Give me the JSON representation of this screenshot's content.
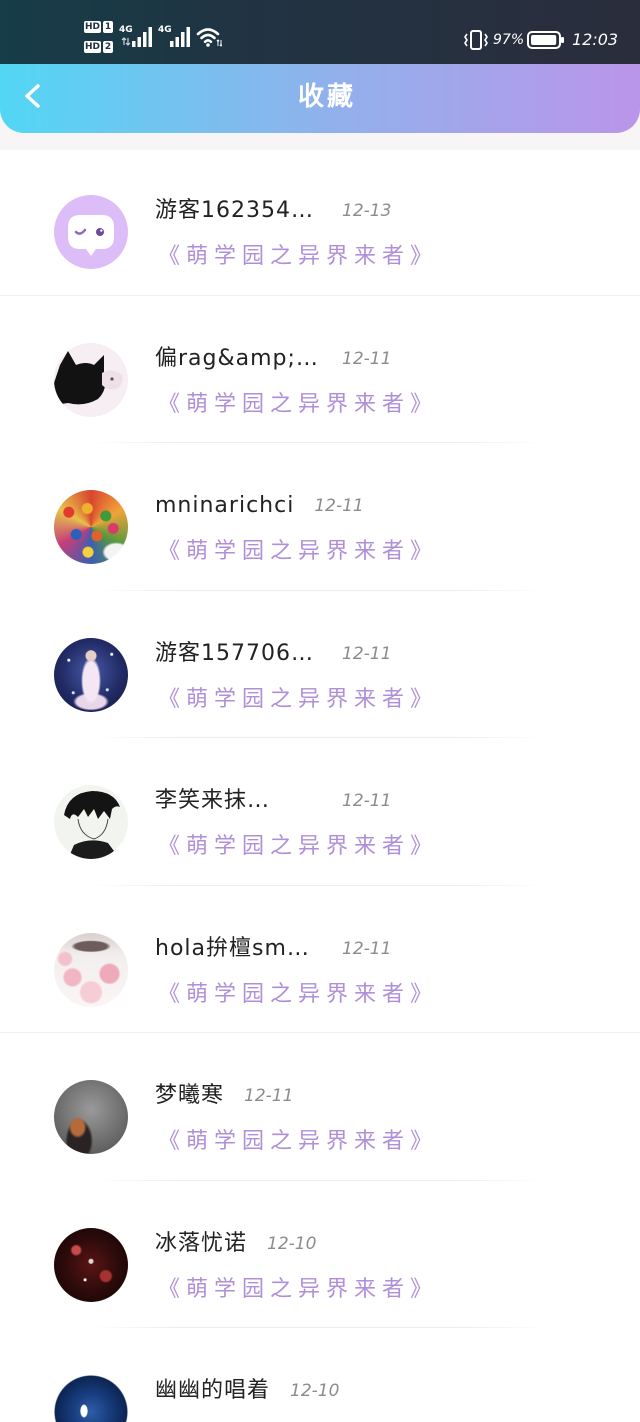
{
  "status_bar": {
    "sim1": {
      "badge": "HD",
      "slot": "1"
    },
    "sim2": {
      "badge": "HD",
      "slot": "2"
    },
    "network1": "4G",
    "network2": "4G",
    "battery_text": "97%",
    "battery_level": 0.97,
    "time": "12:03",
    "icons": [
      "data-activity-icon",
      "signal-bars-icon",
      "wifi-icon",
      "vibrate-icon",
      "battery-icon"
    ]
  },
  "header": {
    "title": "收藏",
    "back_icon": "back-chevron-icon"
  },
  "colors": {
    "header_gradient": [
      "#52d6f4",
      "#8fb2ec",
      "#bb95ea"
    ],
    "name_text": "#222222",
    "date_text": "#8c8c8c",
    "work_title_text": "#b08fd9",
    "avatar_default_bg": "#dcbdf8"
  },
  "favorites": [
    {
      "name": "游客162354…",
      "date": "12-13",
      "work_title": "《萌学园之异界来者》",
      "avatar_icon": "chat-bubble-icon"
    },
    {
      "name": "偏rag&amp;…",
      "date": "12-11",
      "work_title": "《萌学园之异界来者》"
    },
    {
      "name": "mninarichci",
      "date": "12-11",
      "work_title": "《萌学园之异界来者》"
    },
    {
      "name": "游客157706…",
      "date": "12-11",
      "work_title": "《萌学园之异界来者》"
    },
    {
      "name": "李笑来抹…",
      "date": "12-11",
      "work_title": "《萌学园之异界来者》"
    },
    {
      "name": "hola拚檀sm…",
      "date": "12-11",
      "work_title": "《萌学园之异界来者》"
    },
    {
      "name": "梦曦寒",
      "date": "12-11",
      "work_title": "《萌学园之异界来者》"
    },
    {
      "name": "冰落忧诺",
      "date": "12-10",
      "work_title": "《萌学园之异界来者》"
    },
    {
      "name": "幽幽的唱着",
      "date": "12-10"
    }
  ]
}
